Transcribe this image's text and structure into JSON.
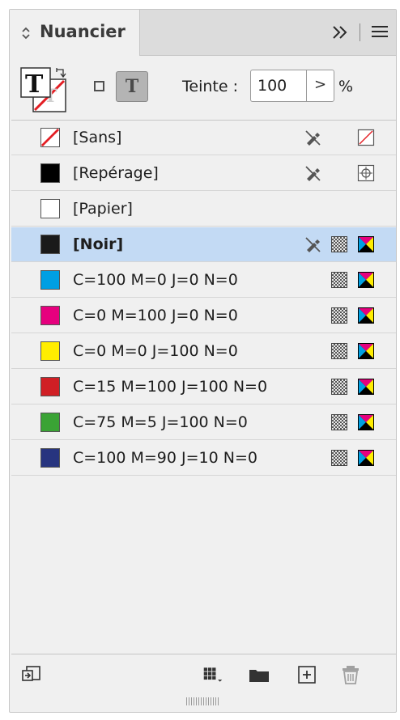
{
  "panel": {
    "title": "Nuancier",
    "collapse_icon": "double-chevron-right-icon",
    "menu_icon": "hamburger-menu-icon"
  },
  "toolbar": {
    "tint_label": "Teinte :",
    "tint_value": "100",
    "tint_stepper": ">",
    "tint_unit": "%",
    "text_button": "T"
  },
  "swatches": [
    {
      "label": "[Sans]",
      "color": "none",
      "icons": [
        "pencil-lock-icon",
        "none-swatch-icon"
      ]
    },
    {
      "label": "[Repérage]",
      "color": "#000000",
      "icons": [
        "pencil-lock-icon",
        "registration-icon"
      ]
    },
    {
      "label": "[Papier]",
      "color": "#ffffff",
      "icons": []
    },
    {
      "label": "[Noir]",
      "color": "#1a1a1a",
      "selected": true,
      "icons": [
        "pencil-lock-icon",
        "process-color-icon",
        "cmyk-icon"
      ]
    },
    {
      "label": "C=100 M=0 J=0 N=0",
      "color": "#009fe3",
      "icons": [
        "process-color-icon",
        "cmyk-icon"
      ]
    },
    {
      "label": "C=0 M=100 J=0 N=0",
      "color": "#e6007e",
      "icons": [
        "process-color-icon",
        "cmyk-icon"
      ]
    },
    {
      "label": "C=0 M=0 J=100 N=0",
      "color": "#ffed00",
      "icons": [
        "process-color-icon",
        "cmyk-icon"
      ]
    },
    {
      "label": "C=15 M=100 J=100 N=0",
      "color": "#d01f25",
      "icons": [
        "process-color-icon",
        "cmyk-icon"
      ]
    },
    {
      "label": "C=75 M=5 J=100 N=0",
      "color": "#3aa335",
      "icons": [
        "process-color-icon",
        "cmyk-icon"
      ]
    },
    {
      "label": "C=100 M=90 J=10 N=0",
      "color": "#27347f",
      "icons": [
        "process-color-icon",
        "cmyk-icon"
      ]
    }
  ],
  "bottom_icons": [
    "place-swatch-icon",
    "swatch-view-icon",
    "new-folder-icon",
    "new-swatch-icon",
    "delete-icon"
  ]
}
